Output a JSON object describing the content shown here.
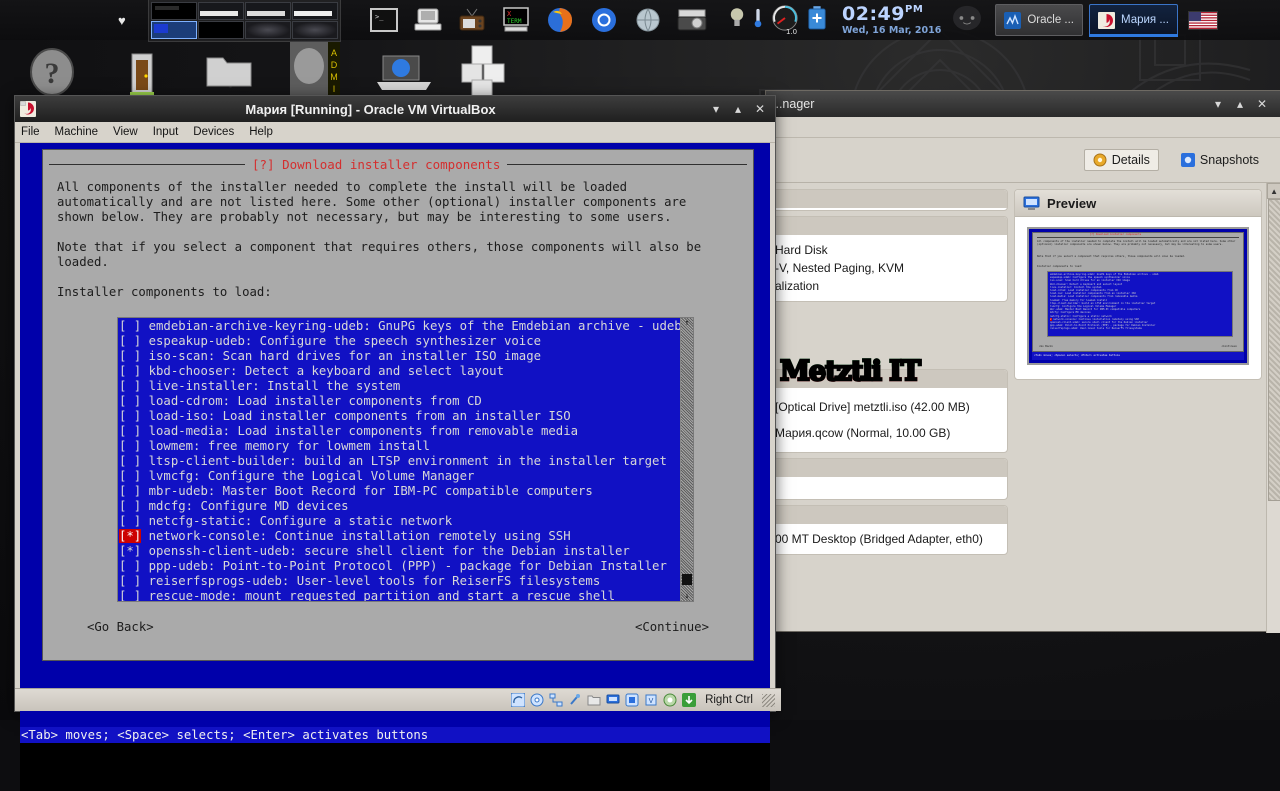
{
  "panel": {
    "clock": {
      "time": "02:49",
      "ampm": "PM",
      "date": "Wed, 16 Mar, 2016"
    },
    "gauge_value": "1.0",
    "heart_glyph": "♥",
    "launchers": [
      {
        "name": "terminal-icon",
        "label": "Terminal"
      },
      {
        "name": "computer-icon",
        "label": "Computer"
      },
      {
        "name": "tv-icon",
        "label": "TV"
      },
      {
        "name": "xterm-icon",
        "label": "XTerm"
      },
      {
        "name": "firefox-icon",
        "label": "Firefox"
      },
      {
        "name": "chromium-icon",
        "label": "Chromium"
      },
      {
        "name": "web-browser-icon",
        "label": "Web Browser"
      },
      {
        "name": "camera-icon",
        "label": "Camera"
      }
    ],
    "tasks": [
      {
        "label": "Oracle ...",
        "active": false
      },
      {
        "label": "Мария ...",
        "active": true
      }
    ],
    "keyboard_layout": "US"
  },
  "desktop_icons": [
    {
      "label": "Help",
      "glyph": "?"
    },
    {
      "label": "Home"
    },
    {
      "label": "Folder"
    },
    {
      "label": "Admin"
    },
    {
      "label": "Network"
    },
    {
      "label": "Packages"
    }
  ],
  "manager_window": {
    "title": "...nager",
    "title_full": "Oracle VM VirtualBox Manager",
    "buttons": {
      "minimize": "▾",
      "maximize": "▴",
      "close": "✕"
    },
    "tabs": [
      {
        "label": "Details",
        "accel": "D",
        "selected": true,
        "icon": "details-icon"
      },
      {
        "label": "Snapshots",
        "accel": "S",
        "selected": false,
        "icon": "snapshots-icon"
      }
    ],
    "details": {
      "storage_lines": [
        "Hard Disk",
        "-V, Nested Paging, KVM",
        "alization"
      ],
      "storage_items": [
        "[Optical Drive] metztli.iso (42.00 MB)",
        "Мария.qcow (Normal, 10.00 GB)"
      ],
      "network_line": "00 MT Desktop (Bridged Adapter, eth0)"
    },
    "preview": {
      "title": "Preview",
      "icon": "monitor-icon"
    },
    "scrollbar": {
      "up_arrow": "▲",
      "down_arrow": "▼"
    }
  },
  "branding": {
    "logo_text": "Metztli IT"
  },
  "vm_window": {
    "title": "Мария [Running] - Oracle VM VirtualBox",
    "icon": "virtualbox-icon",
    "buttons": {
      "minimize": "▾",
      "maximize": "▴",
      "close": "✕"
    },
    "menus": [
      "File",
      "Machine",
      "View",
      "Input",
      "Devices",
      "Help"
    ],
    "status_icons": [
      "hard-disk-icon",
      "optical-disk-icon",
      "network-icon",
      "usb-icon",
      "shared-folders-icon",
      "display-icon",
      "remote-desktop-icon",
      "cpu-icon",
      "mouse-capture-icon",
      "keyboard-capture-icon"
    ],
    "host_key": "Right Ctrl"
  },
  "installer": {
    "dialog_title": "[?] Download installer components",
    "body": "All components of the installer needed to complete the install will be loaded\nautomatically and are not listed here. Some other (optional) installer components are\nshown below. They are probably not necessary, but may be interesting to some users.\n\nNote that if you select a component that requires others, those components will also be\nloaded.\n\nInstaller components to load:",
    "components": [
      {
        "checked": false,
        "cursor": false,
        "text": "emdebian-archive-keyring-udeb: GnuPG keys of the Emdebian archive - udeb"
      },
      {
        "checked": false,
        "cursor": false,
        "text": "espeakup-udeb: Configure the speech synthesizer voice"
      },
      {
        "checked": false,
        "cursor": false,
        "text": "iso-scan: Scan hard drives for an installer ISO image"
      },
      {
        "checked": false,
        "cursor": false,
        "text": "kbd-chooser: Detect a keyboard and select layout"
      },
      {
        "checked": false,
        "cursor": false,
        "text": "live-installer: Install the system"
      },
      {
        "checked": false,
        "cursor": false,
        "text": "load-cdrom: Load installer components from CD"
      },
      {
        "checked": false,
        "cursor": false,
        "text": "load-iso: Load installer components from an installer ISO"
      },
      {
        "checked": false,
        "cursor": false,
        "text": "load-media: Load installer components from removable media"
      },
      {
        "checked": false,
        "cursor": false,
        "text": "lowmem: free memory for lowmem install"
      },
      {
        "checked": false,
        "cursor": false,
        "text": "ltsp-client-builder: build an LTSP environment in the installer target"
      },
      {
        "checked": false,
        "cursor": false,
        "text": "lvmcfg: Configure the Logical Volume Manager"
      },
      {
        "checked": false,
        "cursor": false,
        "text": "mbr-udeb: Master Boot Record for IBM-PC compatible computers"
      },
      {
        "checked": false,
        "cursor": false,
        "text": "mdcfg: Configure MD devices"
      },
      {
        "checked": false,
        "cursor": false,
        "text": "netcfg-static: Configure a static network"
      },
      {
        "checked": true,
        "cursor": true,
        "text": "network-console: Continue installation remotely using SSH"
      },
      {
        "checked": true,
        "cursor": false,
        "text": "openssh-client-udeb: secure shell client for the Debian installer"
      },
      {
        "checked": false,
        "cursor": false,
        "text": "ppp-udeb: Point-to-Point Protocol (PPP) - package for Debian Installer"
      },
      {
        "checked": false,
        "cursor": false,
        "text": "reiserfsprogs-udeb: User-level tools for ReiserFS filesystems"
      },
      {
        "checked": false,
        "cursor": false,
        "text": "rescue-mode: mount requested partition and start a rescue shell"
      }
    ],
    "go_back": "<Go Back>",
    "continue": "<Continue>",
    "help_line": "<Tab> moves; <Space> selects; <Enter> activates buttons",
    "scroll_up": "↑",
    "scroll_down": "↓"
  },
  "colors": {
    "console_blue": "#1111c4",
    "dialog_gray": "#aaaaaa",
    "title_red": "#d42f2f",
    "cursor_red": "#cc0000",
    "accent_blue": "#2f7ae0"
  }
}
